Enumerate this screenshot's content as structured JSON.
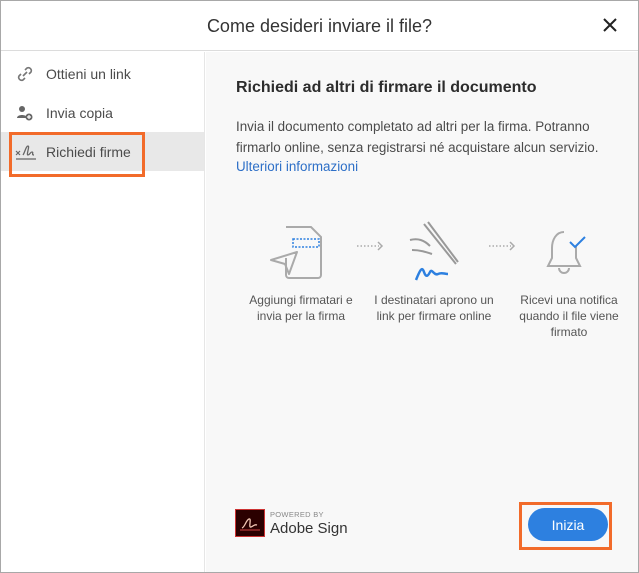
{
  "dialog": {
    "title": "Come desideri inviare il file?"
  },
  "sidebar": {
    "items": [
      {
        "label": "Ottieni un link",
        "icon": "link-icon"
      },
      {
        "label": "Invia copia",
        "icon": "add-user-icon"
      },
      {
        "label": "Richiedi firme",
        "icon": "signature-icon",
        "selected": true
      }
    ]
  },
  "main": {
    "heading": "Richiedi ad altri di firmare il documento",
    "description": "Invia il documento completato ad altri per la firma. Potranno firmarlo online, senza registrarsi né acquistare alcun servizio.",
    "learn_more": "Ulteriori informazioni",
    "steps": [
      {
        "text": "Aggiungi firmatari e invia per la firma",
        "icon": "document-send-icon"
      },
      {
        "text": "I destinatari aprono un link per firmare online",
        "icon": "hand-signing-icon"
      },
      {
        "text": "Ricevi una notifica quando il file viene firmato",
        "icon": "bell-check-icon"
      }
    ],
    "powered_by": "POWERED BY",
    "brand": "Adobe Sign",
    "start_button": "Inizia"
  },
  "colors": {
    "accent": "#2d80e0",
    "highlight": "#f26b2a"
  }
}
